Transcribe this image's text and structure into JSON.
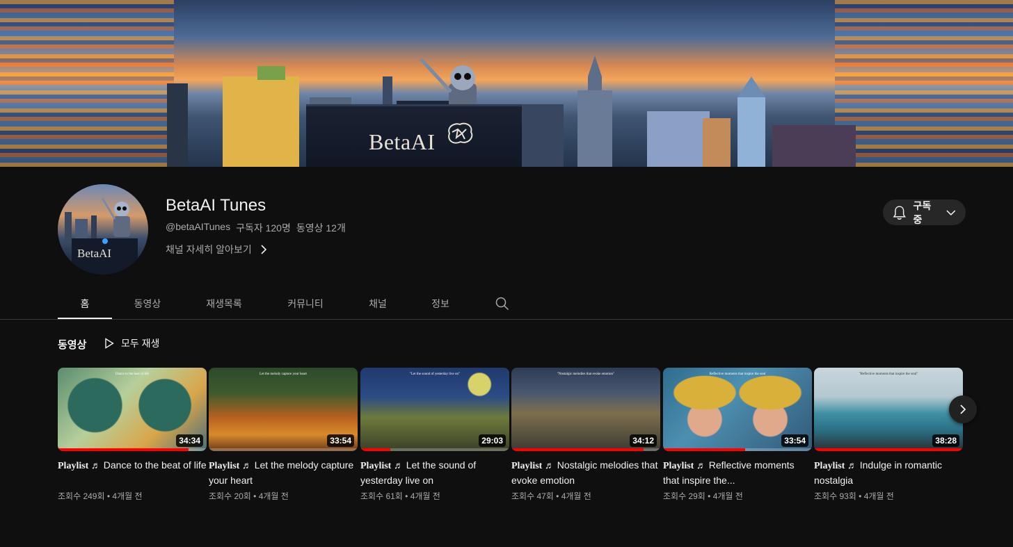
{
  "banner": {
    "logo_text": "BetaAI"
  },
  "channel": {
    "avatar_logo_text": "BetaAI",
    "name": "BetaAI Tunes",
    "handle": "@betaAITunes",
    "subscribers": "구독자 120명",
    "video_count": "동영상 12개",
    "more_link": "채널 자세히 알아보기",
    "subscribe_label": "구독중"
  },
  "tabs": [
    {
      "label": "홈",
      "active": true
    },
    {
      "label": "동영상",
      "active": false
    },
    {
      "label": "재생목록",
      "active": false
    },
    {
      "label": "커뮤니티",
      "active": false
    },
    {
      "label": "채널",
      "active": false
    },
    {
      "label": "정보",
      "active": false
    }
  ],
  "section": {
    "title": "동영상",
    "play_all_label": "모두 재생"
  },
  "videos": [
    {
      "prefix": "Playlist ♬",
      "title": "Dance to the beat of life",
      "duration": "34:34",
      "views": "조회수 249회",
      "age": "4개월 전",
      "thumb_caption": "Dance to the beat of life",
      "progress": 0.88
    },
    {
      "prefix": "Playlist ♬",
      "title": "Let the melody capture your heart",
      "duration": "33:54",
      "views": "조회수 20회",
      "age": "4개월 전",
      "thumb_caption": "Let the melody capture your heart",
      "progress": 0.0
    },
    {
      "prefix": "Playlist ♬",
      "title": "Let the sound of yesterday live on",
      "duration": "29:03",
      "views": "조회수 61회",
      "age": "4개월 전",
      "thumb_caption": "\"Let the sound of yesterday live on\"",
      "progress": 0.2
    },
    {
      "prefix": "Playlist ♬",
      "title": "Nostalgic melodies that evoke emotion",
      "duration": "34:12",
      "views": "조회수 47회",
      "age": "4개월 전",
      "thumb_caption": "\"Nostalgic melodies that evoke emotion\"",
      "progress": 0.89
    },
    {
      "prefix": "Playlist ♬",
      "title": "Reflective moments that inspire the...",
      "duration": "33:54",
      "views": "조회수 29회",
      "age": "4개월 전",
      "thumb_caption": "Reflective moments that inspire the soul",
      "progress": 0.55
    },
    {
      "prefix": "Playlist ♬",
      "title": "Indulge in romantic nostalgia",
      "duration": "38:28",
      "views": "조회수 93회",
      "age": "4개월 전",
      "thumb_caption": "\"Reflective moments that inspire the soul\"",
      "progress": 1.0
    }
  ],
  "colors": {
    "background": "#0f0f0f",
    "progress": "#ff0000",
    "button_bg": "#272727",
    "secondary_text": "#aaaaaa"
  }
}
